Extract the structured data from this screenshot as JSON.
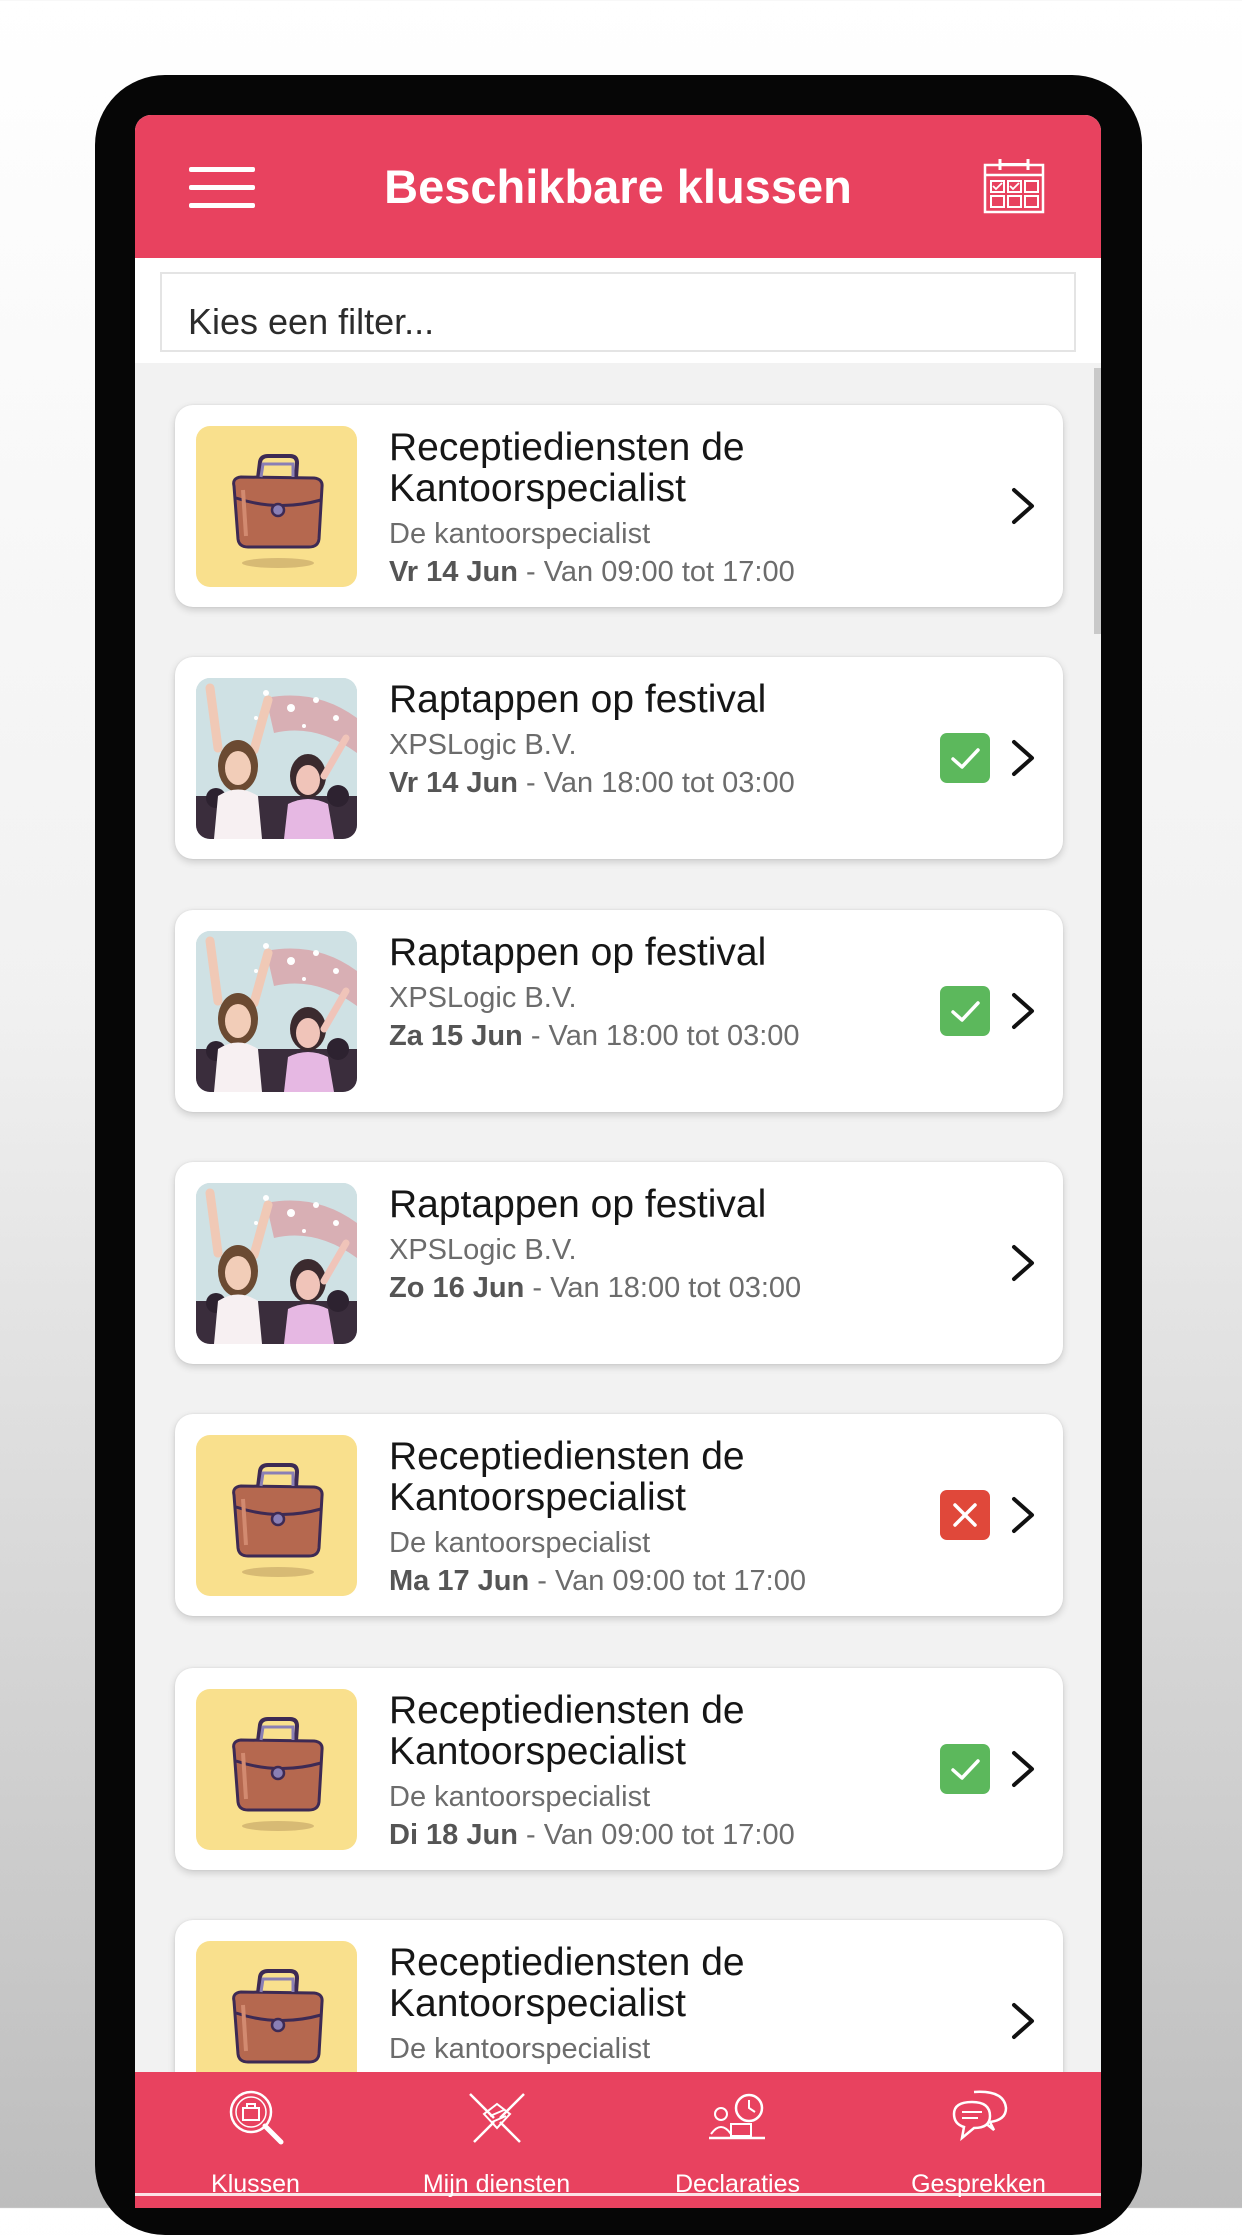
{
  "header": {
    "title": "Beschikbare klussen",
    "menu_icon": "hamburger-menu-icon",
    "calendar_icon": "calendar-icon"
  },
  "filter": {
    "placeholder": "Kies een filter..."
  },
  "jobs": [
    {
      "title_line1": "Receptiediensten de",
      "title_line2": "Kantoorspecialist",
      "company": "De kantoorspecialist",
      "day": "Vr 14 Jun",
      "time": " - Van 09:00 tot 17:00",
      "image": "briefcase",
      "status": "none"
    },
    {
      "title_line1": "Raptappen op festival",
      "title_line2": "",
      "company": "XPSLogic B.V.",
      "day": "Vr 14 Jun",
      "time": " - Van 18:00 tot 03:00",
      "image": "festival-photo",
      "status": "accepted"
    },
    {
      "title_line1": "Raptappen op festival",
      "title_line2": "",
      "company": "XPSLogic B.V.",
      "day": "Za 15 Jun",
      "time": " - Van 18:00 tot 03:00",
      "image": "festival-photo",
      "status": "accepted"
    },
    {
      "title_line1": "Raptappen op festival",
      "title_line2": "",
      "company": "XPSLogic B.V.",
      "day": "Zo 16 Jun",
      "time": " - Van 18:00 tot 03:00",
      "image": "festival-photo",
      "status": "none"
    },
    {
      "title_line1": "Receptiediensten de",
      "title_line2": "Kantoorspecialist",
      "company": "De kantoorspecialist",
      "day": "Ma 17 Jun",
      "time": " - Van 09:00 tot 17:00",
      "image": "briefcase",
      "status": "declined"
    },
    {
      "title_line1": "Receptiediensten de",
      "title_line2": "Kantoorspecialist",
      "company": "De kantoorspecialist",
      "day": "Di 18 Jun",
      "time": " - Van 09:00 tot 17:00",
      "image": "briefcase",
      "status": "accepted"
    },
    {
      "title_line1": "Receptiediensten de",
      "title_line2": "Kantoorspecialist",
      "company": "De kantoorspecialist",
      "day": "",
      "time": "",
      "image": "briefcase",
      "status": "none"
    }
  ],
  "nav": {
    "items": [
      {
        "label": "Klussen",
        "icon": "search-jobs-icon",
        "active": true
      },
      {
        "label": "Mijn diensten",
        "icon": "handshake-icon",
        "active": false
      },
      {
        "label": "Declaraties",
        "icon": "expenses-icon",
        "active": false
      },
      {
        "label": "Gesprekken",
        "icon": "chat-bubbles-icon",
        "active": false
      }
    ]
  },
  "colors": {
    "accent": "#e8425f",
    "accepted": "#5cb85c",
    "declined": "#e0483a",
    "thumb_bg": "#f9e08d"
  }
}
